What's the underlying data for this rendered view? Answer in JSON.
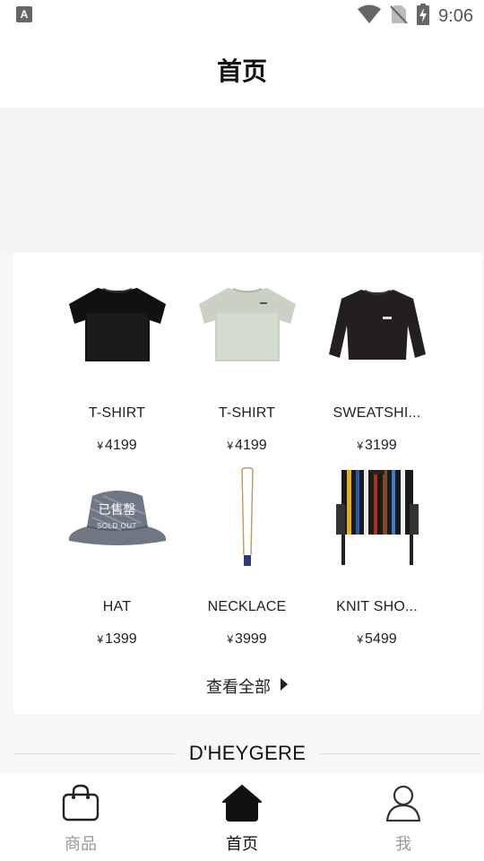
{
  "status_bar": {
    "time": "9:06",
    "left_icon": "keyboard-a-icon",
    "icons": [
      "wifi-icon",
      "no-sim-icon",
      "battery-charging-icon"
    ]
  },
  "header": {
    "title": "首页"
  },
  "products": [
    {
      "name": "T-SHIRT",
      "currency": "¥",
      "price": "4199",
      "image": "black-tshirt"
    },
    {
      "name": "T-SHIRT",
      "currency": "¥",
      "price": "4199",
      "image": "sage-tshirt"
    },
    {
      "name": "SWEATSHI...",
      "currency": "¥",
      "price": "3199",
      "image": "black-sweatshirt"
    },
    {
      "name": "HAT",
      "currency": "¥",
      "price": "1399",
      "image": "bucket-hat",
      "sold_out_cn": "已售罄",
      "sold_out_en": "SOLD OUT"
    },
    {
      "name": "NECKLACE",
      "currency": "¥",
      "price": "3999",
      "image": "necklace"
    },
    {
      "name": "KNIT SHO...",
      "currency": "¥",
      "price": "5499",
      "image": "knit-shorts"
    }
  ],
  "view_all": {
    "label": "查看全部"
  },
  "brand": {
    "name": "D'HEYGERE"
  },
  "tab_bar": {
    "tabs": [
      {
        "label": "商品",
        "icon": "shopping-bag-icon",
        "active": false
      },
      {
        "label": "首页",
        "icon": "home-icon",
        "active": true
      },
      {
        "label": "我",
        "icon": "user-icon",
        "active": false
      }
    ]
  },
  "colors": {
    "active": "#111111",
    "inactive": "#999999",
    "background": "#f7f7f7"
  }
}
